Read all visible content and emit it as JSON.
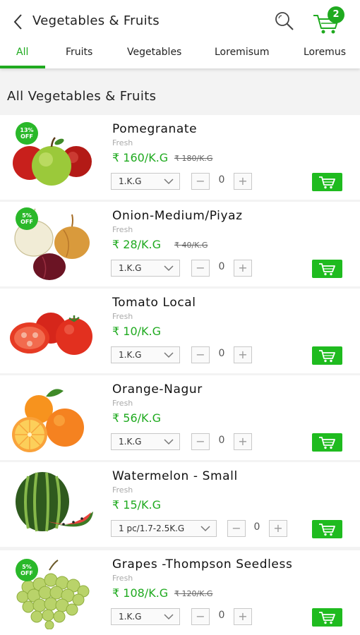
{
  "header": {
    "title": "Vegetables & Fruits",
    "cart_count": "2"
  },
  "tabs": [
    "All",
    "Fruits",
    "Vegetables",
    "Loremisum",
    "Loremus"
  ],
  "active_tab": "All",
  "section_title": "All Vegetables & Fruits",
  "colors": {
    "accent": "#1faa1f",
    "badge": "#2ab82a"
  },
  "products": [
    {
      "name": "Pomegranate",
      "subtitle": "Fresh",
      "price": "₹ 160/K.G",
      "old_price": "₹ 180/K.G",
      "discount": "13% OFF",
      "unit": "1.K.G",
      "qty": "0",
      "image": "apples"
    },
    {
      "name": "Onion-Medium/Piyaz",
      "subtitle": "Fresh",
      "price": "₹ 28/K.G",
      "old_price": "₹ 40/K.G",
      "discount": "5% OFF",
      "unit": "1.K.G",
      "qty": "0",
      "image": "onions"
    },
    {
      "name": "Tomato Local",
      "subtitle": "Fresh",
      "price": "₹ 10/K.G",
      "old_price": "",
      "discount": "",
      "unit": "1.K.G",
      "qty": "0",
      "image": "tomatoes"
    },
    {
      "name": "Orange-Nagur",
      "subtitle": "Fresh",
      "price": "₹ 56/K.G",
      "old_price": "",
      "discount": "",
      "unit": "1.K.G",
      "qty": "0",
      "image": "oranges"
    },
    {
      "name": "Watermelon - Small",
      "subtitle": "Fresh",
      "price": "₹ 15/K.G",
      "old_price": "",
      "discount": "",
      "unit": "1 pc/1.7-2.5K.G",
      "qty": "0",
      "image": "watermelon"
    },
    {
      "name": "Grapes -Thompson Seedless",
      "subtitle": "Fresh",
      "price": "₹ 108/K.G",
      "old_price": "₹ 120/K.G",
      "discount": "5% OFF",
      "unit": "1.K.G",
      "qty": "0",
      "image": "grapes"
    }
  ]
}
